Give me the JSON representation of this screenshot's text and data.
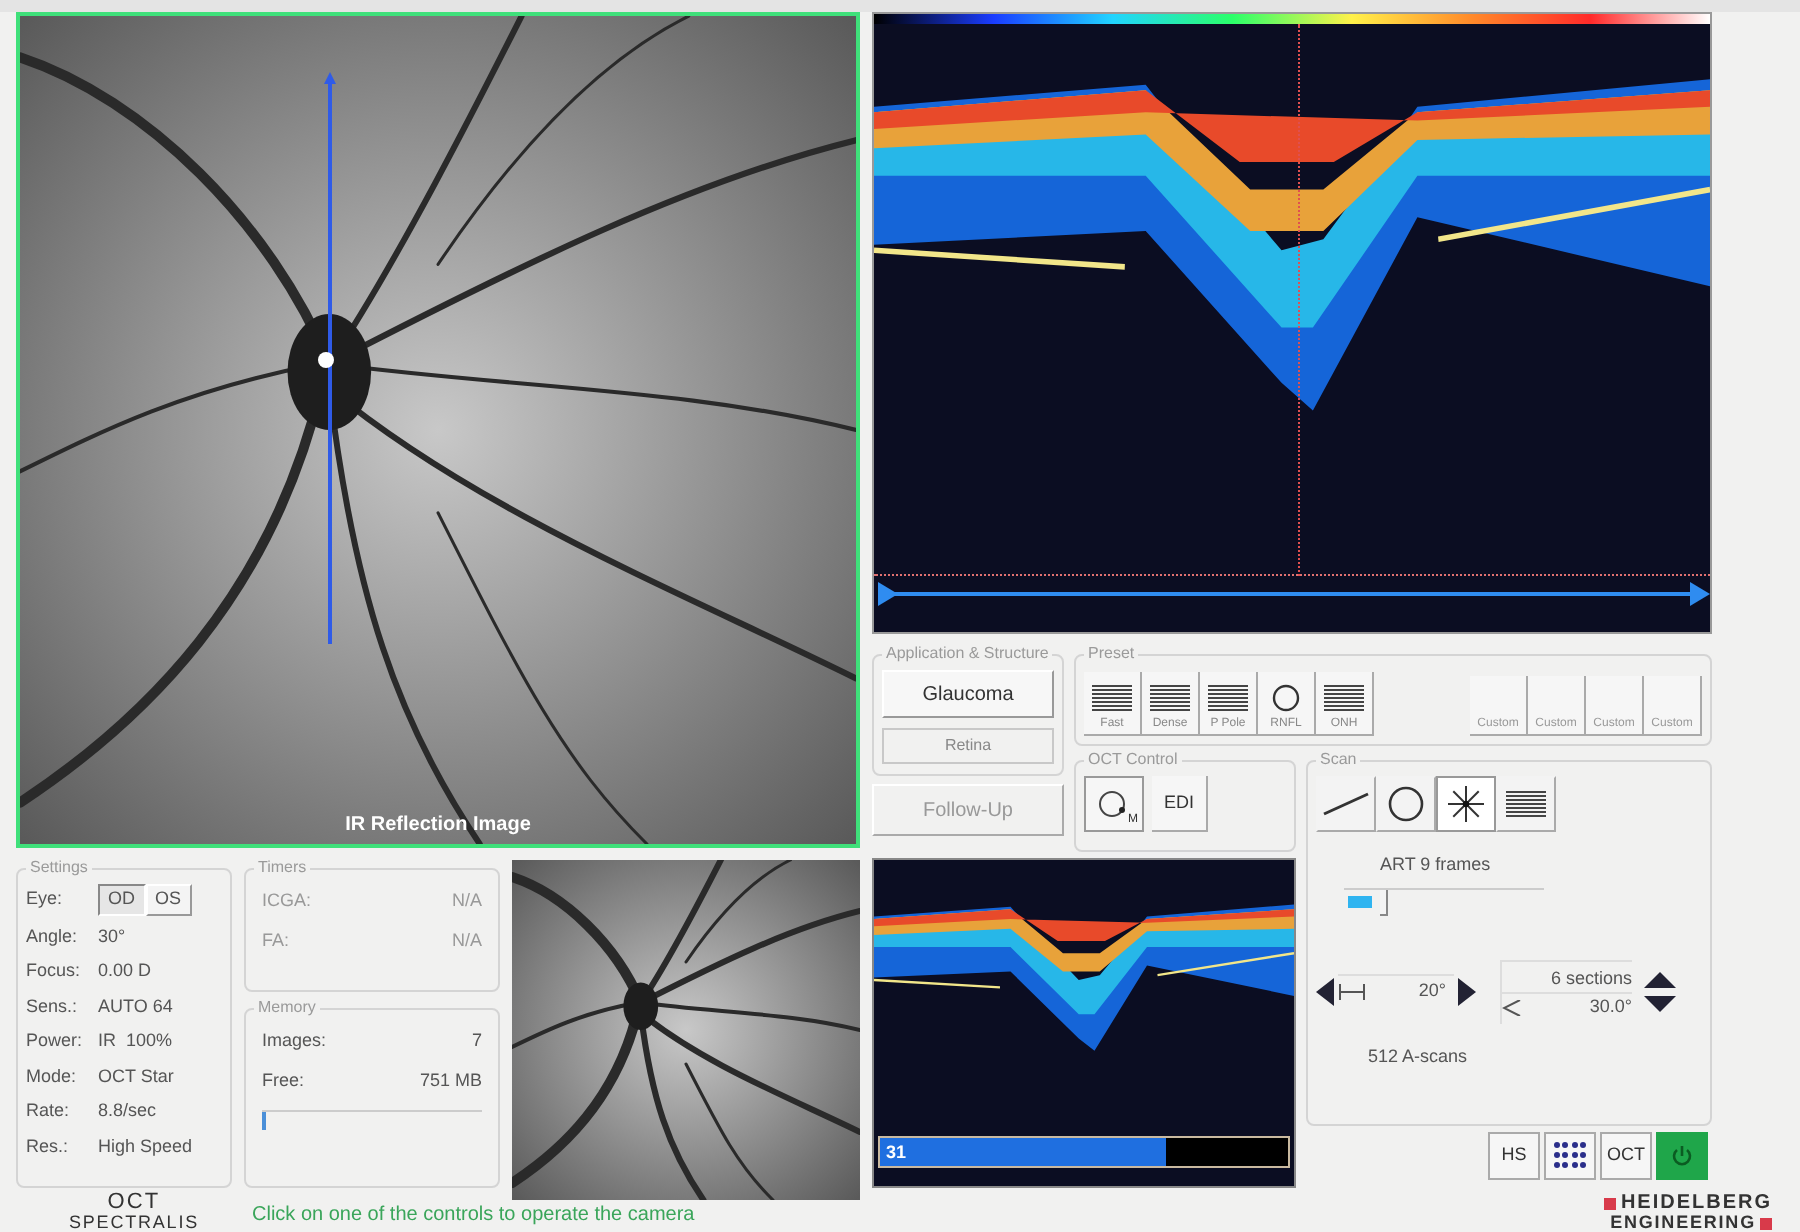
{
  "ir_image": {
    "caption": "IR Reflection Image"
  },
  "app_structure": {
    "title": "Application & Structure",
    "application": "Glaucoma",
    "structure": "Retina",
    "follow_up": {
      "label": "Follow-Up",
      "disabled": true
    }
  },
  "preset": {
    "title": "Preset",
    "items": [
      {
        "label": "Fast",
        "kind": "lines"
      },
      {
        "label": "Dense",
        "kind": "lines"
      },
      {
        "label": "P Pole",
        "kind": "lines"
      },
      {
        "label": "RNFL",
        "kind": "circle"
      },
      {
        "label": "ONH",
        "kind": "lines"
      }
    ],
    "custom": [
      "Custom",
      "Custom",
      "Custom",
      "Custom"
    ]
  },
  "oct_control": {
    "title": "OCT Control",
    "mode_badge": "M",
    "edi": "EDI"
  },
  "scan": {
    "title": "Scan",
    "patterns": [
      {
        "kind": "line",
        "selected": false
      },
      {
        "kind": "circle",
        "selected": false
      },
      {
        "kind": "star",
        "selected": true
      },
      {
        "kind": "raster",
        "selected": false
      }
    ],
    "art": "ART 9 frames",
    "art_level": {
      "level": 0.12
    },
    "width": "20°",
    "sections": "6 sections",
    "angle": "30.0°",
    "ascans": "512 A-scans"
  },
  "settings": {
    "title": "Settings",
    "eye_label": "Eye:",
    "eyes": [
      {
        "label": "OD",
        "selected": true
      },
      {
        "label": "OS",
        "selected": false
      }
    ],
    "rows": [
      {
        "label": "Angle:",
        "value": "30°"
      },
      {
        "label": "Focus:",
        "value": "0.00 D"
      },
      {
        "label": "Sens.:",
        "value": "AUTO 64"
      },
      {
        "label": "Power:",
        "value": "IR  100%"
      },
      {
        "label": "Mode:",
        "value": "OCT Star"
      },
      {
        "label": "Rate:",
        "value": "8.8/sec"
      },
      {
        "label": "Res.:",
        "value": "High Speed"
      }
    ]
  },
  "timers": {
    "title": "Timers",
    "disabled": true,
    "rows": [
      {
        "label": "ICGA:",
        "value": "N/A"
      },
      {
        "label": "FA:",
        "value": "N/A"
      }
    ]
  },
  "memory": {
    "title": "Memory",
    "rows": [
      {
        "label": "Images:",
        "value": "7"
      },
      {
        "label": "Free:",
        "value": "751 MB"
      }
    ],
    "level": 0.02
  },
  "oct_preview": {
    "frames": "31",
    "level": 0.7
  },
  "toolbar": [
    {
      "kind": "text",
      "label": "HS"
    },
    {
      "kind": "grid"
    },
    {
      "kind": "text",
      "label": "OCT"
    },
    {
      "kind": "power"
    }
  ],
  "logo": {
    "line1": "OCT",
    "line2": "SPECTRALIS"
  },
  "status": "Click on one of the controls to operate the camera",
  "brand": {
    "line1": "HEIDELBERG",
    "line2": "ENGINEERING"
  }
}
